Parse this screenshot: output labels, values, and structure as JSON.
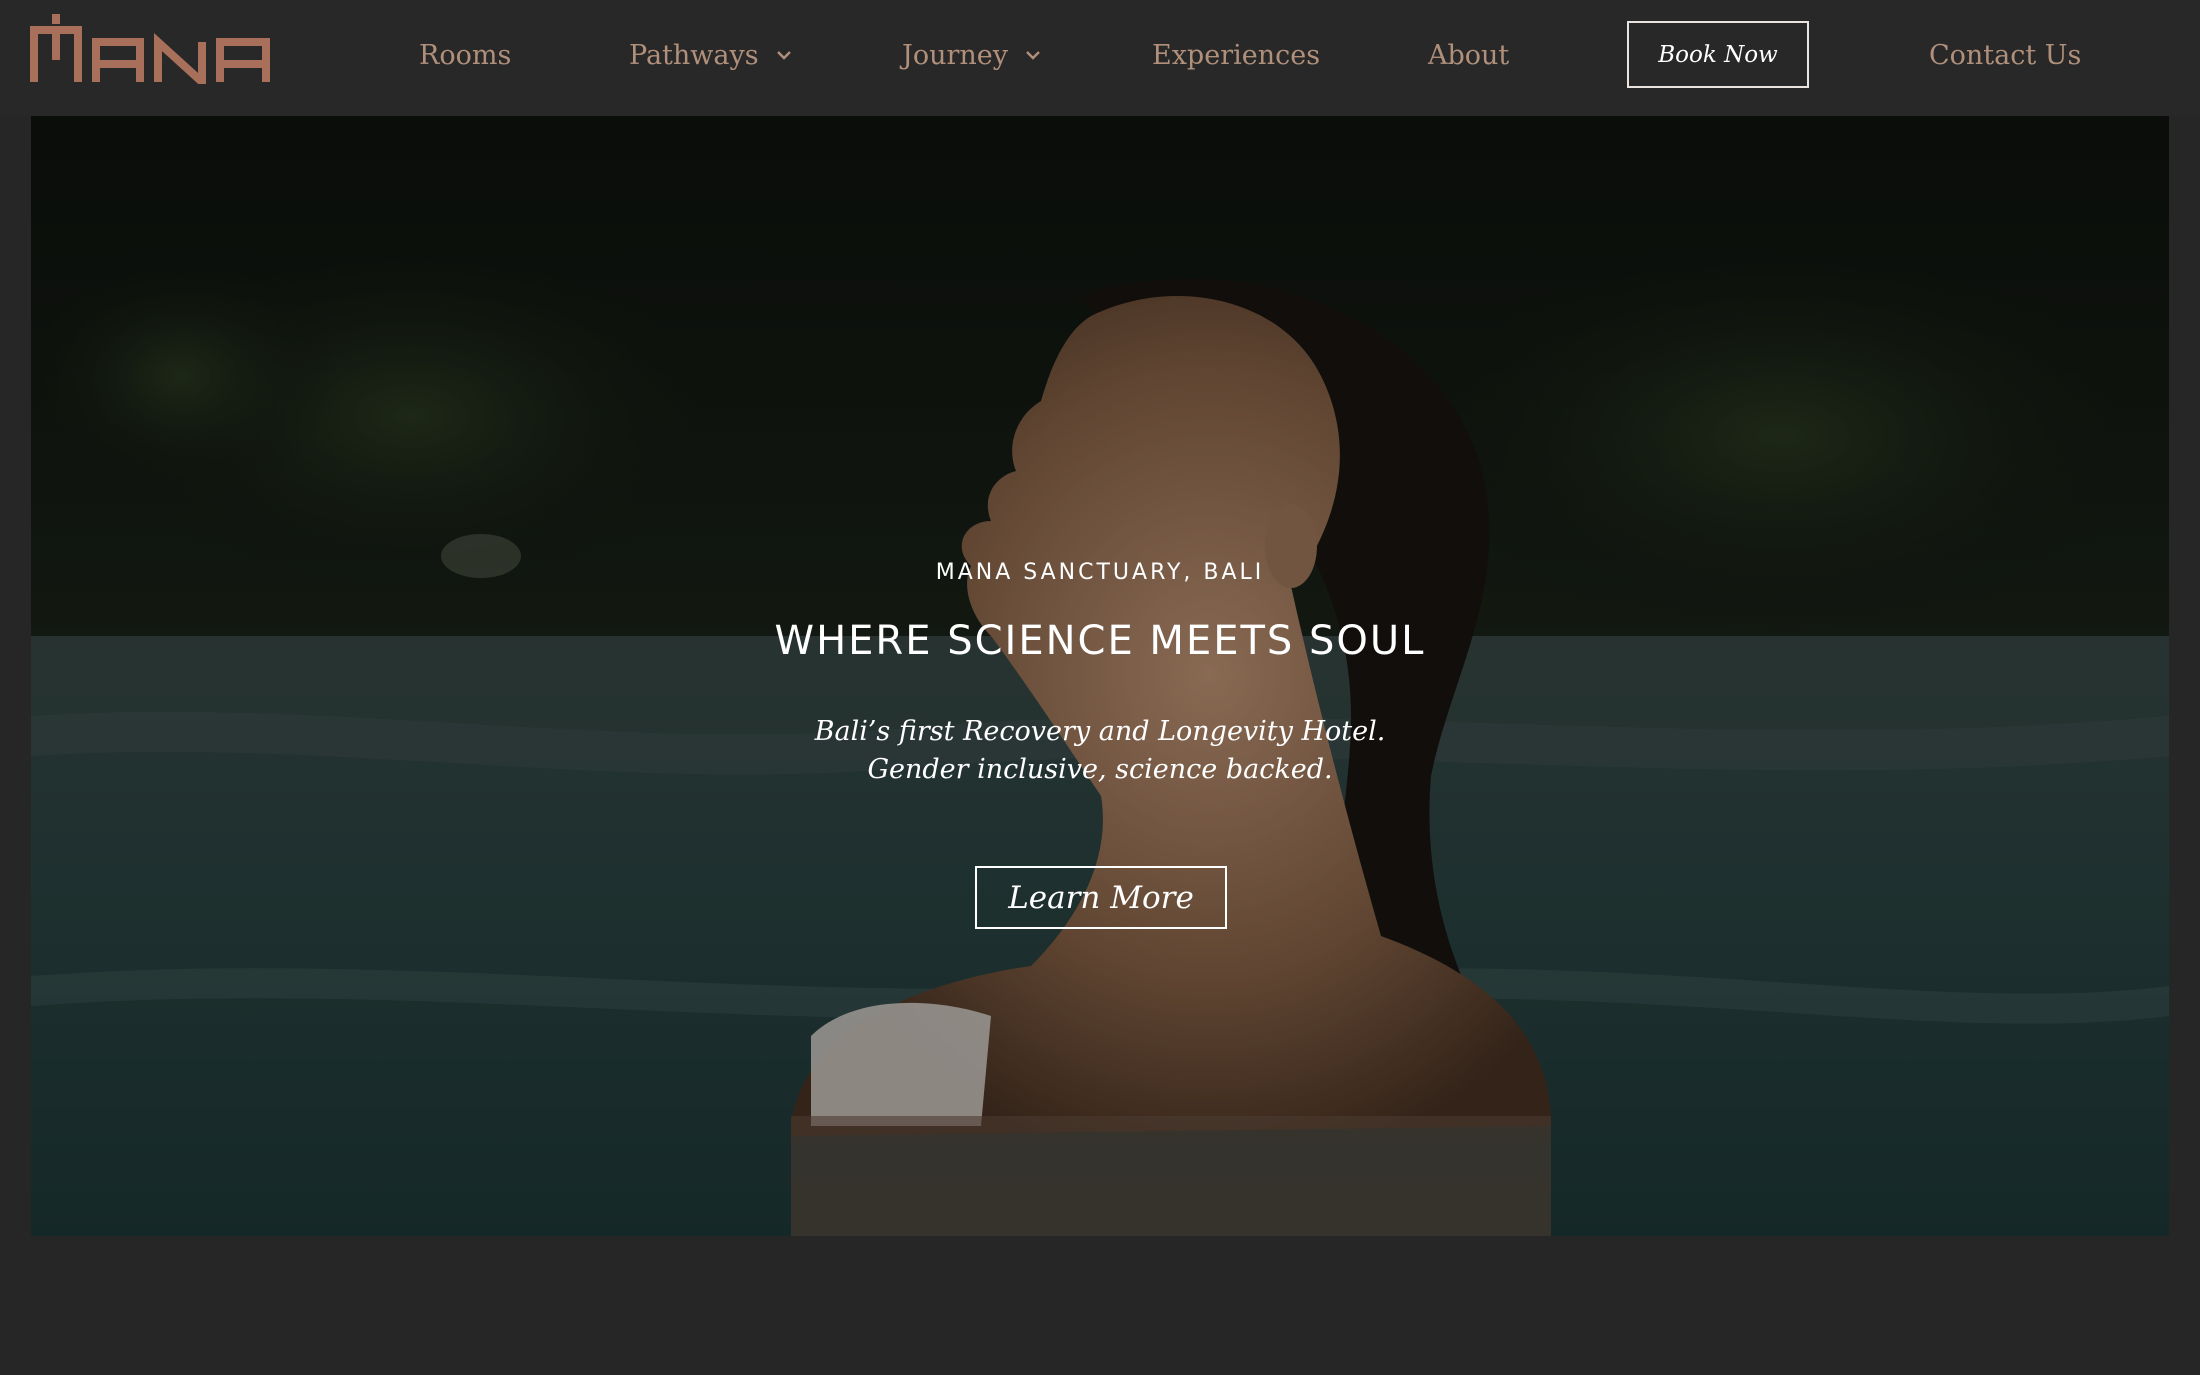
{
  "brand": {
    "logo_text": "MANA",
    "accent_color": "#a8705b",
    "nav_text_color": "#b1907b"
  },
  "nav": {
    "items": [
      {
        "label": "Rooms",
        "has_dropdown": false
      },
      {
        "label": "Pathways",
        "has_dropdown": true,
        "icon": "chevron-down-icon"
      },
      {
        "label": "Journey",
        "has_dropdown": true,
        "icon": "chevron-down-icon"
      },
      {
        "label": "Experiences",
        "has_dropdown": false
      },
      {
        "label": "About",
        "has_dropdown": false
      }
    ],
    "book_label": "Book Now",
    "contact_label": "Contact Us"
  },
  "hero": {
    "image": "woman-in-pool-photo",
    "eyebrow": "MANA SANCTUARY, BALI",
    "headline": "WHERE SCIENCE MEETS SOUL",
    "tagline_line1": "Bali’s first Recovery and Longevity Hotel.",
    "tagline_line2": "Gender inclusive, science backed.",
    "cta_label": "Learn More"
  }
}
